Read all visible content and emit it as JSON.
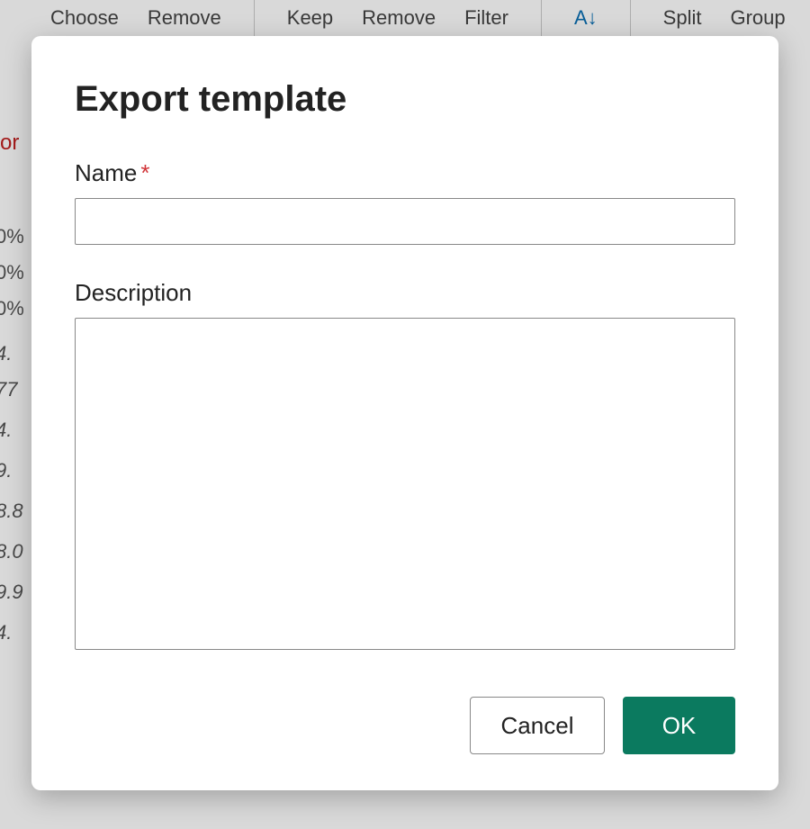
{
  "toolbar": {
    "choose": "Choose",
    "remove1": "Remove",
    "keep": "Keep",
    "remove2": "Remove",
    "filter": "Filter",
    "sort": "A↓",
    "split": "Split",
    "group": "Group"
  },
  "background": {
    "red_text": "or",
    "rows": [
      "0%",
      "0%",
      "0%",
      "4.",
      "77",
      "4.",
      "9.",
      "8.8",
      "8.0",
      "9.9",
      "4."
    ]
  },
  "dialog": {
    "title": "Export template",
    "name_label": "Name",
    "required": "*",
    "description_label": "Description",
    "name_value": "",
    "description_value": "",
    "cancel": "Cancel",
    "ok": "OK"
  }
}
